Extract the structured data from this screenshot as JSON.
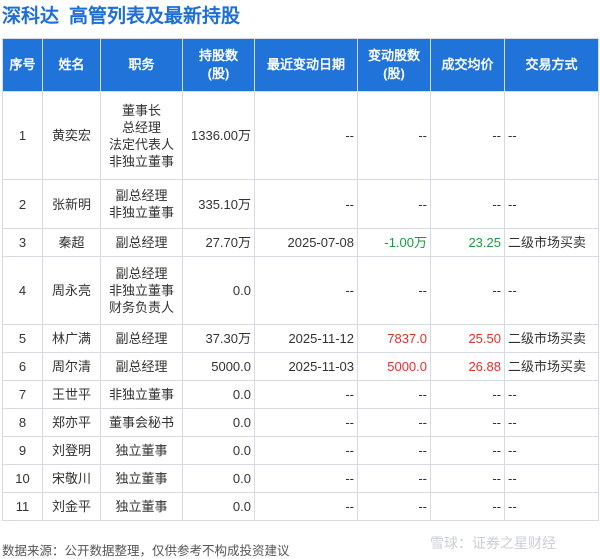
{
  "title": {
    "stock": "深科达",
    "text": "高管列表及最新持股"
  },
  "table": {
    "headers": [
      "序号",
      "姓名",
      "职务",
      "持股数\n(股)",
      "最近变动日期",
      "变动股数\n(股)",
      "成交均价",
      "交易方式"
    ],
    "rows": [
      {
        "index": "1",
        "name": "黄奕宏",
        "positions": [
          "董事长",
          "总经理",
          "法定代表人",
          "非独立董事"
        ],
        "shares": "1336.00万",
        "date": "--",
        "change": "--",
        "price": "--",
        "method": "--",
        "height": 88
      },
      {
        "index": "2",
        "name": "张新明",
        "positions": [
          "副总经理",
          "非独立董事"
        ],
        "shares": "335.10万",
        "date": "--",
        "change": "--",
        "price": "--",
        "method": "--",
        "height": 49
      },
      {
        "index": "3",
        "name": "秦超",
        "positions": [
          "副总经理"
        ],
        "shares": "27.70万",
        "date": "2025-07-08",
        "change": "-1.00万",
        "changeColor": "green",
        "price": "23.25",
        "priceColor": "green",
        "method": "二级市场买卖",
        "height": 28
      },
      {
        "index": "4",
        "name": "周永亮",
        "positions": [
          "副总经理",
          "非独立董事",
          "财务负责人"
        ],
        "shares": "0.0",
        "date": "--",
        "change": "--",
        "price": "--",
        "method": "--",
        "height": 68
      },
      {
        "index": "5",
        "name": "林广满",
        "positions": [
          "副总经理"
        ],
        "shares": "37.30万",
        "date": "2025-11-12",
        "change": "7837.0",
        "changeColor": "red",
        "price": "25.50",
        "priceColor": "red",
        "method": "二级市场买卖",
        "height": 28
      },
      {
        "index": "6",
        "name": "周尔清",
        "positions": [
          "副总经理"
        ],
        "shares": "5000.0",
        "date": "2025-11-03",
        "change": "5000.0",
        "changeColor": "red",
        "price": "26.88",
        "priceColor": "red",
        "method": "二级市场买卖",
        "height": 28
      },
      {
        "index": "7",
        "name": "王世平",
        "positions": [
          "非独立董事"
        ],
        "shares": "0.0",
        "date": "--",
        "change": "--",
        "price": "--",
        "method": "--",
        "height": 28
      },
      {
        "index": "8",
        "name": "郑亦平",
        "positions": [
          "董事会秘书"
        ],
        "shares": "0.0",
        "date": "--",
        "change": "--",
        "price": "--",
        "method": "--",
        "height": 28
      },
      {
        "index": "9",
        "name": "刘登明",
        "positions": [
          "独立董事"
        ],
        "shares": "0.0",
        "date": "--",
        "change": "--",
        "price": "--",
        "method": "--",
        "height": 28
      },
      {
        "index": "10",
        "name": "宋敬川",
        "positions": [
          "独立董事"
        ],
        "shares": "0.0",
        "date": "--",
        "change": "--",
        "price": "--",
        "method": "--",
        "height": 28
      },
      {
        "index": "11",
        "name": "刘金平",
        "positions": [
          "独立董事"
        ],
        "shares": "0.0",
        "date": "--",
        "change": "--",
        "price": "--",
        "method": "--",
        "height": 28
      }
    ]
  },
  "footer": {
    "source": "数据来源：公开数据整理，仅供参考不构成投资建议"
  },
  "watermark": {
    "text": "雪球：证券之星财经"
  },
  "colors": {
    "title": "#1b6fd6",
    "header_bg": "#1f73d9",
    "up": "#e0302b",
    "down": "#1a9a3a"
  }
}
